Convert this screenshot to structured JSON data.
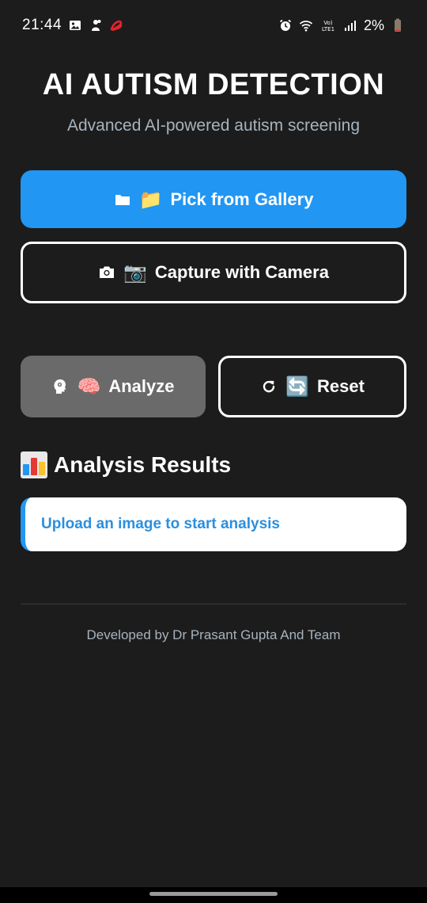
{
  "status_bar": {
    "time": "21:44",
    "battery": "2%",
    "icons_left": [
      "gallery-icon",
      "notification-icon",
      "airtel-icon"
    ],
    "icons_right": [
      "alarm-icon",
      "wifi-icon",
      "volte-icon",
      "signal-icon",
      "battery-icon"
    ],
    "volte_label": "Vo) LTE1"
  },
  "header": {
    "title": "AI AUTISM DETECTION",
    "subtitle": "Advanced AI-powered autism screening"
  },
  "buttons": {
    "gallery": {
      "icon": "folder-icon",
      "emoji": "📁",
      "label": "Pick from Gallery"
    },
    "camera": {
      "icon": "camera-icon",
      "emoji": "📷",
      "label": "Capture with Camera"
    },
    "analyze": {
      "icon": "head-brain-icon",
      "emoji": "🧠",
      "label": "Analyze"
    },
    "reset": {
      "icon": "refresh-icon",
      "emoji": "🔄",
      "label": "Reset"
    }
  },
  "results": {
    "icon": "bar-chart-icon",
    "heading": "Analysis Results",
    "message": "Upload an image to start analysis"
  },
  "footer": {
    "credit": "Developed by Dr Prasant Gupta And Team"
  },
  "colors": {
    "background": "#1c1c1c",
    "primary": "#2196f3",
    "disabled_button": "#6a6a6a",
    "result_text": "#2b8fde",
    "subtle_text": "#a7b3bd"
  }
}
